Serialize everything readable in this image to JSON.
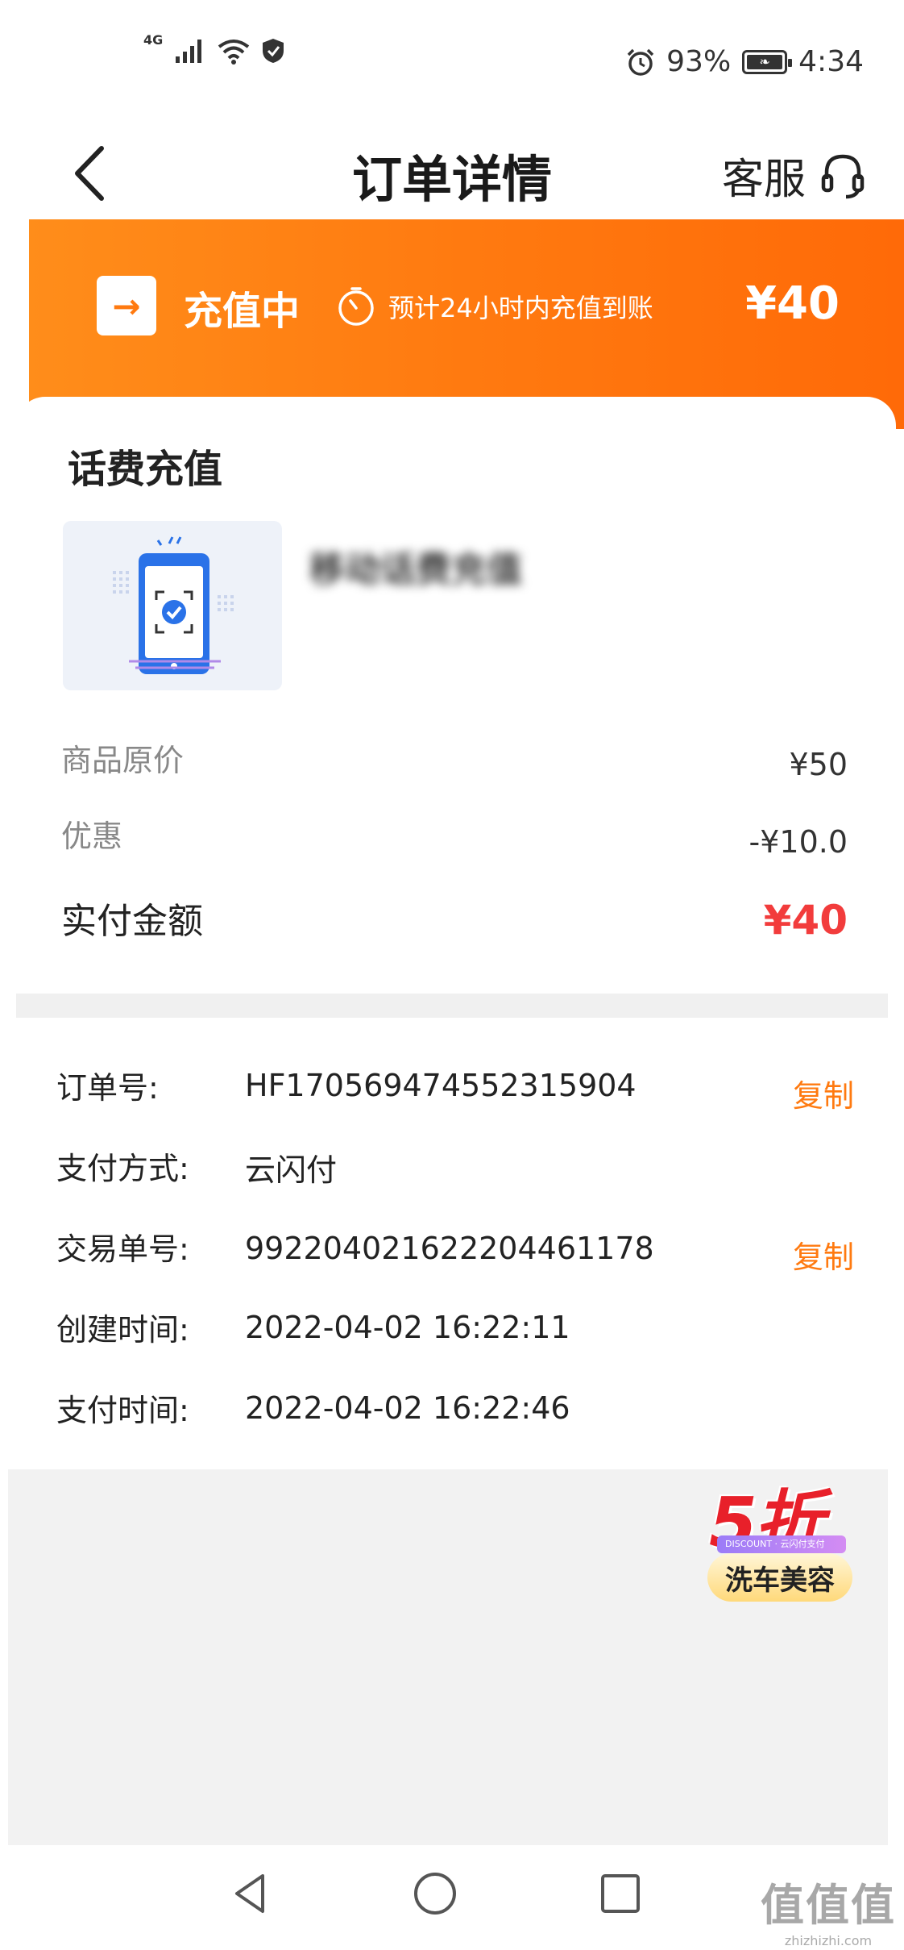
{
  "status_bar": {
    "network": "4G",
    "battery": "93%",
    "time": "4:34",
    "icons": [
      "signal-icon",
      "wifi-icon",
      "shield-icon",
      "alarm-icon",
      "battery-icon"
    ]
  },
  "header": {
    "title": "订单详情",
    "service_label": "客服",
    "back_icon": "chevron-left-icon",
    "service_icon": "headset-icon"
  },
  "banner": {
    "status": "充值中",
    "timer_text": "预计24小时内充值到账",
    "amount": "¥40",
    "color": "#ff7a10"
  },
  "card": {
    "title": "话费充值",
    "product_name": "移动话费充值",
    "product_sub": "",
    "original_price_label": "商品原价",
    "original_price": "¥50",
    "discount_label": "优惠",
    "discount": "-¥10.0",
    "paid_label": "实付金额",
    "paid": "¥40",
    "paid_color": "#f23c3c"
  },
  "order_info": {
    "order_no_label": "订单号:",
    "order_no": "HF170569474552315904",
    "copy_label": "复制",
    "pay_method_label": "支付方式:",
    "pay_method": "云闪付",
    "trade_no_label": "交易单号:",
    "trade_no": "992204021622204461178",
    "created_label": "创建时间:",
    "created": "2022-04-02 16:22:11",
    "paid_time_label": "支付时间:",
    "paid_time": "2022-04-02 16:22:46"
  },
  "promo": {
    "big_text": "5折",
    "strip_text": "DISCOUNT · 云闪付支付",
    "chip_text": "洗车美容"
  },
  "nav": {
    "icons": [
      "back-triangle-icon",
      "home-circle-icon",
      "recent-square-icon"
    ]
  },
  "watermark": {
    "text": "值值值",
    "url": "zhizhizhi.com"
  }
}
